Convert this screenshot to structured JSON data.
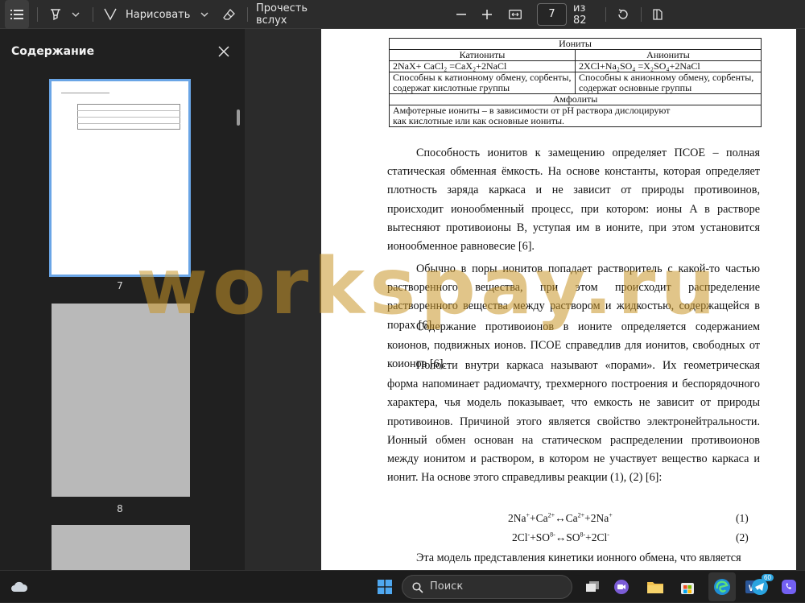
{
  "toolbar": {
    "toc_icon": "list-icon",
    "highlight_icon": "highlighter-icon",
    "chevron_icon": "chevron-down-icon",
    "draw_label": "Нарисовать",
    "draw_icon": "pen-icon",
    "eraser_icon": "eraser-icon",
    "read_aloud_label": "Прочесть вслух",
    "zoom_out_icon": "minus-icon",
    "zoom_in_icon": "plus-icon",
    "fit_icon": "fit-width-icon",
    "page_current": "7",
    "page_total": "из 82",
    "rotate_icon": "rotate-icon",
    "view_icon": "page-view-icon"
  },
  "sidebar": {
    "title": "Содержание",
    "close_icon": "close-icon",
    "pages": [
      {
        "number": "7",
        "selected": true
      },
      {
        "number": "8",
        "selected": false
      }
    ]
  },
  "document": {
    "table": {
      "header": "Иониты",
      "col1": "Катиониты",
      "col2": "Аниониты",
      "row1_left": "2NaX+ CaCl₂ =CaX₂+2NaCl",
      "row1_right": "2XCl+Na₂SO₄ =X₂SO₄+2NaCl",
      "row2_left": "Способны к катионному обмену, сорбенты, содержат кислотные группы",
      "row2_right": "Способны к анионному обмену, сорбенты, содержат основные группы",
      "ampho_header": "Амфолиты",
      "ampho_text": "Амфотерные иониты – в зависимости от pH раствора дислоцируют как кислотные или как основные иониты."
    },
    "p1": "Способность ионитов к замещению определяет ПСОЕ – полная статическая обменная ёмкость. На основе константы, которая определяет плотность заряда каркаса и не зависит от природы противоинов, происходит ионообменный процесс, при котором: ионы A в растворе вытесняют противоионы B, уступая им в ионите, при этом установится ионообменное равновесие [6].",
    "p2": "Обычно в поры ионитов попадает растворитель с какой-то частью растворенного вещества, при этом происходит распределение растворенного вещества между раствором и жидкостью, содержащейся в порах [6].",
    "p3": "Содержание противоионов в ионите определяется содержанием коионов, подвижных ионов. ПСОЕ справедлив для ионитов, свободных от коионов [6].",
    "p4": "Полости внутри каркаса называют «порами». Их геометрическая форма напоминает радиомачту, трехмерного построения и беспорядочного характера, чья модель показывает, что емкость не зависит от природы противоинов. Причиной этого является свойство электронейтральности. Ионный обмен основан на статическом распределении противоионов между ионитом и раствором, в котором не участвует вещество каркаса и ионит. На основе этого справедливы реакции (1), (2) [6]:",
    "f1_num": "(1)",
    "f2_num": "(2)",
    "p5": "Эта модель представления кинетики ионного обмена, что является"
  },
  "watermark": "workspay.ru",
  "taskbar": {
    "weather_icon": "weather-cloud-icon",
    "start_icon": "windows-start-icon",
    "search_label": "Поиск",
    "search_icon": "search-icon",
    "apps": [
      "task-view-icon",
      "video-chat-icon",
      "file-explorer-icon",
      "store-icon",
      "edge-icon",
      "word-icon",
      "telegram-icon",
      "viber-icon"
    ],
    "telegram_badge": "60"
  },
  "colors": {
    "accent": "#6aa5e6",
    "watermark": "#c8962a"
  }
}
